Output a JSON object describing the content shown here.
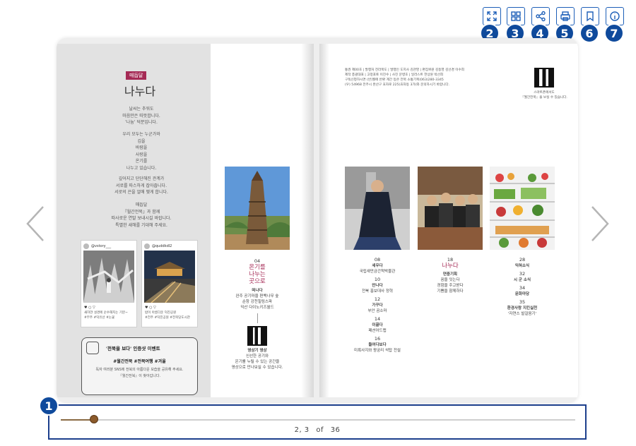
{
  "toolbar": {
    "buttons": [
      {
        "icon": "fullscreen-icon",
        "callout": "2"
      },
      {
        "icon": "thumbnails-grid-icon",
        "callout": "3"
      },
      {
        "icon": "share-icon",
        "callout": "4"
      },
      {
        "icon": "print-icon",
        "callout": "5"
      },
      {
        "icon": "bookmark-icon",
        "callout": "6"
      },
      {
        "icon": "info-icon",
        "callout": "7"
      }
    ],
    "accent": "#1d5fb8"
  },
  "slider": {
    "callout": "1",
    "current_pages": "2, 3",
    "of_label": "of",
    "total_pages": "36",
    "progress_fraction": 0.065,
    "thumb_color": "#8b5a2b"
  },
  "left_page": {
    "badge": "매듭달",
    "title": "나누다",
    "poem": [
      [
        "날씨는 추워도",
        "마음만은 따뜻합니다.",
        "'나눔' 덕분입니다."
      ],
      [
        "우리 모두는 누군가와",
        "김을",
        "바람을",
        "사랑을",
        "온기를",
        "나누고 있습니다."
      ],
      [
        "깊어지고 단단해진 관계가",
        "서로를 따스하게 잡아줍니다.",
        "서로의 끈을 얼매 맺게 합니다."
      ],
      [
        "매듭달",
        "『월간전북』과 함께",
        "따사로운 연말 보내시길 바랍니다.",
        "특별한 새해를 기대해 주세요."
      ]
    ],
    "cards": [
      {
        "handle": "@vstory___",
        "reactions": "♥ ○ ▽",
        "caption": [
          "새하얀 설경에 순수해지는 기분~",
          "#무주 #덕유산 #눈꽃"
        ]
      },
      {
        "handle": "@quddkdl2",
        "reactions": "♥ ○ ▽",
        "caption": [
          "밤이 아름다운 덕진공원",
          "#전주 #덕진공원 #전북당도시관"
        ]
      }
    ],
    "event": {
      "title": "'전북을 보다' 인증샷 이벤트",
      "tags": "#월간전북 #전북여행 #겨울",
      "desc": [
        "독자 여러분 SNS에 전북의 아름다운 모습을 공유해 주세요.",
        "『월간전북』이 찾아갑니다."
      ]
    }
  },
  "middle_column": {
    "number": "04",
    "feature_title": [
      "온기를",
      "나누는",
      "곳으로"
    ],
    "section": "떠나다",
    "desc": [
      "완주 공기마을 편백나무 숲",
      "순창 강천힐링스파",
      "익산 다이노키즈월드"
    ],
    "video_title": "영상기 영상",
    "video_desc": [
      "신선한 공기와",
      "온기를 누릴 수 있는 공간을",
      "영상으로 만나보실 수 있습니다."
    ]
  },
  "right_page": {
    "credits": [
      "통권 제00호 | 발행처 전라북도 | 발행인 도지사 김관영 | 편집위원 김동영 김선경 이수희",
      "제작 총괄대표 | 고정포토 이진수 | 사진 문병호 | 일러스트 한상원 박선희",
      "구독신청하시면 (반)월에 반환 계간 등은 전북 소통기획(063)280-3345",
      "(우) 54968 전주시 완산구 효자로 225(효자동 3가)와 문의하시기 바랍니다."
    ],
    "qr_caption": [
      "스마트폰에서도",
      "『월간전북』을 보실 수 있습니다."
    ],
    "toc": [
      {
        "items": [
          {
            "num": "08",
            "section": "세우다",
            "desc": "국립새만금간척박물관"
          },
          {
            "num": "10",
            "section": "만나다",
            "desc": "전북 홍보대사 정혁"
          },
          {
            "num": "12",
            "section": "가꾸다",
            "desc": "부안 곰소마"
          },
          {
            "num": "14",
            "section": "이끌다",
            "desc": "패션어드랩"
          },
          {
            "num": "16",
            "section": "들여다보다",
            "desc": "미륵사지와 왕궁리 석탑 전설"
          }
        ]
      },
      {
        "num": "18",
        "feature": "나누다",
        "section": "연중기획",
        "desc": [
          "꿈을 잇는다",
          "경험을 주고받다",
          "기쁨을 함께하다"
        ]
      },
      {
        "items": [
          {
            "num": "28",
            "section": "익혀소식",
            "desc": ""
          },
          {
            "num": "32",
            "section": "시 군 소식",
            "desc": ""
          },
          {
            "num": "34",
            "section": "문화마당",
            "desc": ""
          },
          {
            "num": "35",
            "section": "환경사랑 지킨실천",
            "desc": "'자연스 발걸음기'"
          }
        ]
      }
    ]
  }
}
